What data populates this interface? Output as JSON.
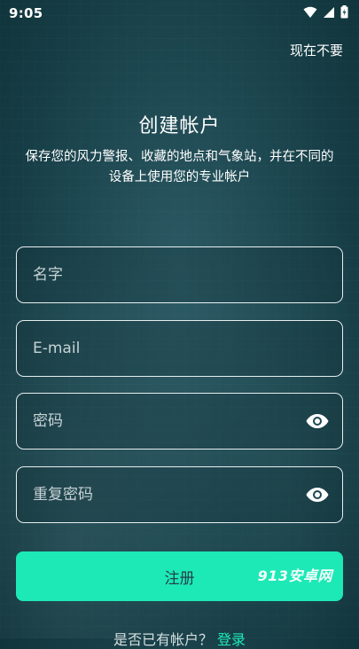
{
  "status_bar": {
    "time": "9:05",
    "icons": [
      "wifi-icon",
      "signal-icon",
      "battery-icon"
    ]
  },
  "header": {
    "skip_label": "现在不要"
  },
  "main": {
    "title": "创建帐户",
    "subtitle": "保存您的风力警报、收藏的地点和气象站，并在不同的设备上使用您的专业帐户"
  },
  "form": {
    "name_placeholder": "名字",
    "email_placeholder": "E-mail",
    "password_placeholder": "密码",
    "confirm_password_placeholder": "重复密码",
    "register_label": "注册"
  },
  "watermark": "913安卓网",
  "footer": {
    "question": "是否已有帐户？",
    "login_label": "登录"
  },
  "colors": {
    "accent": "#1de9b6",
    "background": "#1d4750"
  }
}
